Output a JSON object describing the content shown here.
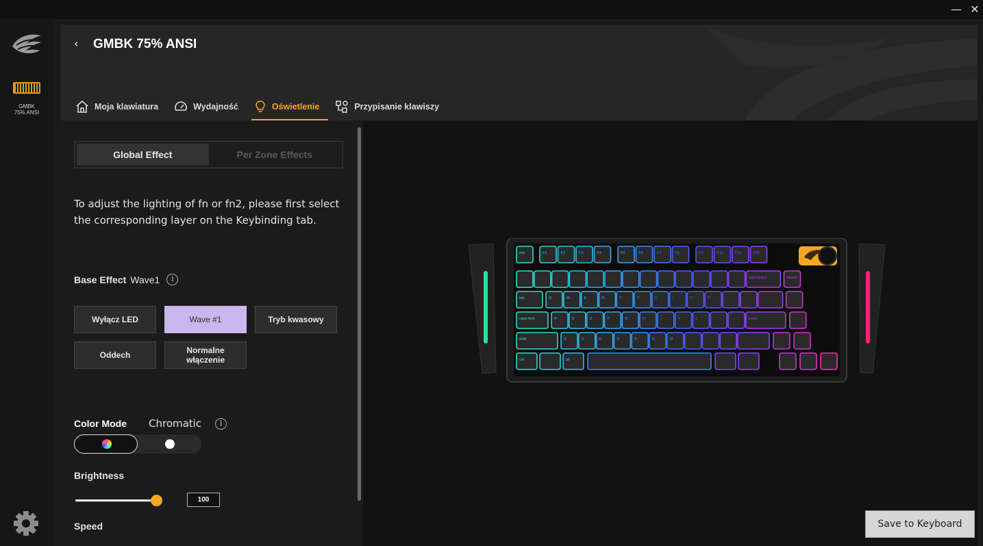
{
  "window": {
    "minimize_label": "—",
    "close_label": "✕"
  },
  "rail": {
    "device_label": "GMBK\n75% ANSI",
    "logo_icon": "brand-wing-icon",
    "settings_icon": "gear-icon"
  },
  "header": {
    "back_label": "‹",
    "title": "GMBK 75% ANSI",
    "tabs": [
      {
        "label": "Moja klawiatura",
        "icon": "home-icon"
      },
      {
        "label": "Wydajność",
        "icon": "speedometer-icon"
      },
      {
        "label": "Oświetlenie",
        "icon": "lightbulb-icon",
        "active": true
      },
      {
        "label": "Przypisanie klawiszy",
        "icon": "keymap-icon"
      }
    ]
  },
  "lighting": {
    "segments": {
      "global": "Global Effect",
      "per_zone": "Per Zone Effects"
    },
    "info_text": "To adjust the lighting of fn or fn2, please first select the corresponding layer on the Keybinding tab.",
    "base_effect": {
      "label": "Base Effect",
      "value": "Wave1"
    },
    "effects": {
      "off": "Wyłącz LED",
      "wave": "Wave #1",
      "acid": "Tryb kwasowy",
      "breath": "Oddech",
      "normal": "Normalne\nwłączenie"
    },
    "color_mode": {
      "label": "Color Mode",
      "value": "Chromatic"
    },
    "brightness": {
      "label": "Brightness",
      "value": "100"
    },
    "speed": {
      "label": "Speed"
    }
  },
  "keyboard": {
    "row0": [
      "esc",
      "F1",
      "F2",
      "F3",
      "F4",
      "F5",
      "F6",
      "F7",
      "F8",
      "F9",
      "F10",
      "F11",
      "F12"
    ],
    "esc_key": "esc",
    "tab_key": "tab",
    "caps_key": "caps lock",
    "shift_key": "shift",
    "ctrl_key": "ctrl",
    "alt_key": "alt",
    "backspace_key": "backspace",
    "delete_key": "delete",
    "enter_key": "enter",
    "row2_letters": [
      "Q",
      "W",
      "E",
      "R",
      "T",
      "Y",
      "U",
      "I",
      "O",
      "P"
    ],
    "row3_letters": [
      "A",
      "S",
      "D",
      "F",
      "G",
      "H",
      "J",
      "K",
      "L"
    ],
    "row4_letters": [
      "Z",
      "X",
      "C",
      "V",
      "B",
      "N",
      "M"
    ],
    "accent_colors": {
      "teal": "#2ee6c8",
      "blue": "#2f7bff",
      "purple": "#9b3cff",
      "pink": "#ff2fa8",
      "orange": "#f5a623"
    }
  },
  "actions": {
    "save_label": "Save to Keyboard"
  },
  "colors": {
    "accent": "#f5a623",
    "selected_effect": "#c9b8ee"
  }
}
